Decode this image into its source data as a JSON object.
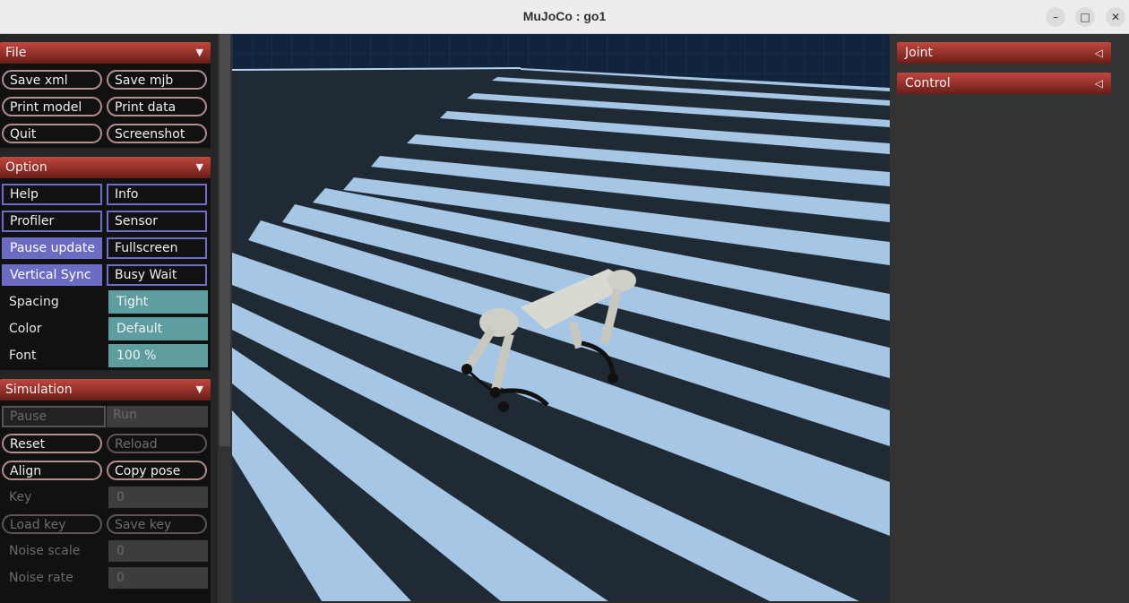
{
  "window": {
    "title": "MuJoCo : go1",
    "minimize": "–",
    "maximize": "□",
    "close": "✕"
  },
  "file": {
    "header": "File",
    "arrow": "▼",
    "save_xml": "Save xml",
    "save_mjb": "Save mjb",
    "print_model": "Print model",
    "print_data": "Print data",
    "quit": "Quit",
    "screenshot": "Screenshot"
  },
  "option": {
    "header": "Option",
    "arrow": "▼",
    "help": "Help",
    "info": "Info",
    "profiler": "Profiler",
    "sensor": "Sensor",
    "pause_update": "Pause update",
    "fullscreen": "Fullscreen",
    "vertical_sync": "Vertical Sync",
    "busy_wait": "Busy Wait",
    "spacing_label": "Spacing",
    "spacing_value": "Tight",
    "color_label": "Color",
    "color_value": "Default",
    "font_label": "Font",
    "font_value": "100 %"
  },
  "simulation": {
    "header": "Simulation",
    "arrow": "▼",
    "pause": "Pause",
    "run": "Run",
    "reset": "Reset",
    "reload": "Reload",
    "align": "Align",
    "copy_pose": "Copy pose",
    "key_label": "Key",
    "key_value": "0",
    "load_key": "Load key",
    "save_key": "Save key",
    "noise_scale_label": "Noise scale",
    "noise_scale_value": "0",
    "noise_rate_label": "Noise rate",
    "noise_rate_value": "0"
  },
  "right": {
    "joint": "Joint",
    "control": "Control",
    "arrow": "◁"
  },
  "colors": {
    "header_top": "#c0473f",
    "header_bottom": "#6a1d18",
    "toggle_on": "#6b6bc2",
    "value_fill": "#5e9ea0",
    "stair_top": "#a6c6e6",
    "stair_riser": "#1f2a35"
  }
}
